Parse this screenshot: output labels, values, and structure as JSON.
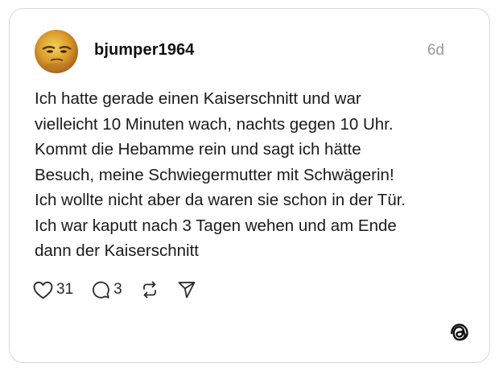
{
  "post": {
    "username": "bjumper1964",
    "time": "6d",
    "lines": [
      "Ich hatte gerade einen Kaiserschnitt und war",
      "vielleicht 10 Minuten wach, nachts gegen 10 Uhr.",
      "Kommt die Hebamme rein und sagt ich hätte",
      "Besuch, meine Schwiegermutter mit Schwägerin!",
      "Ich wollte nicht aber da waren sie schon in der Tür.",
      "Ich war kaputt nach 3 Tagen wehen und am Ende",
      "dann der Kaiserschnitt"
    ]
  },
  "actions": {
    "like_count": "31",
    "reply_count": "3",
    "icons": [
      "heart-icon",
      "comment-icon",
      "repost-icon",
      "share-icon"
    ]
  },
  "brand": {
    "logo_icon": "threads-logo-icon"
  }
}
